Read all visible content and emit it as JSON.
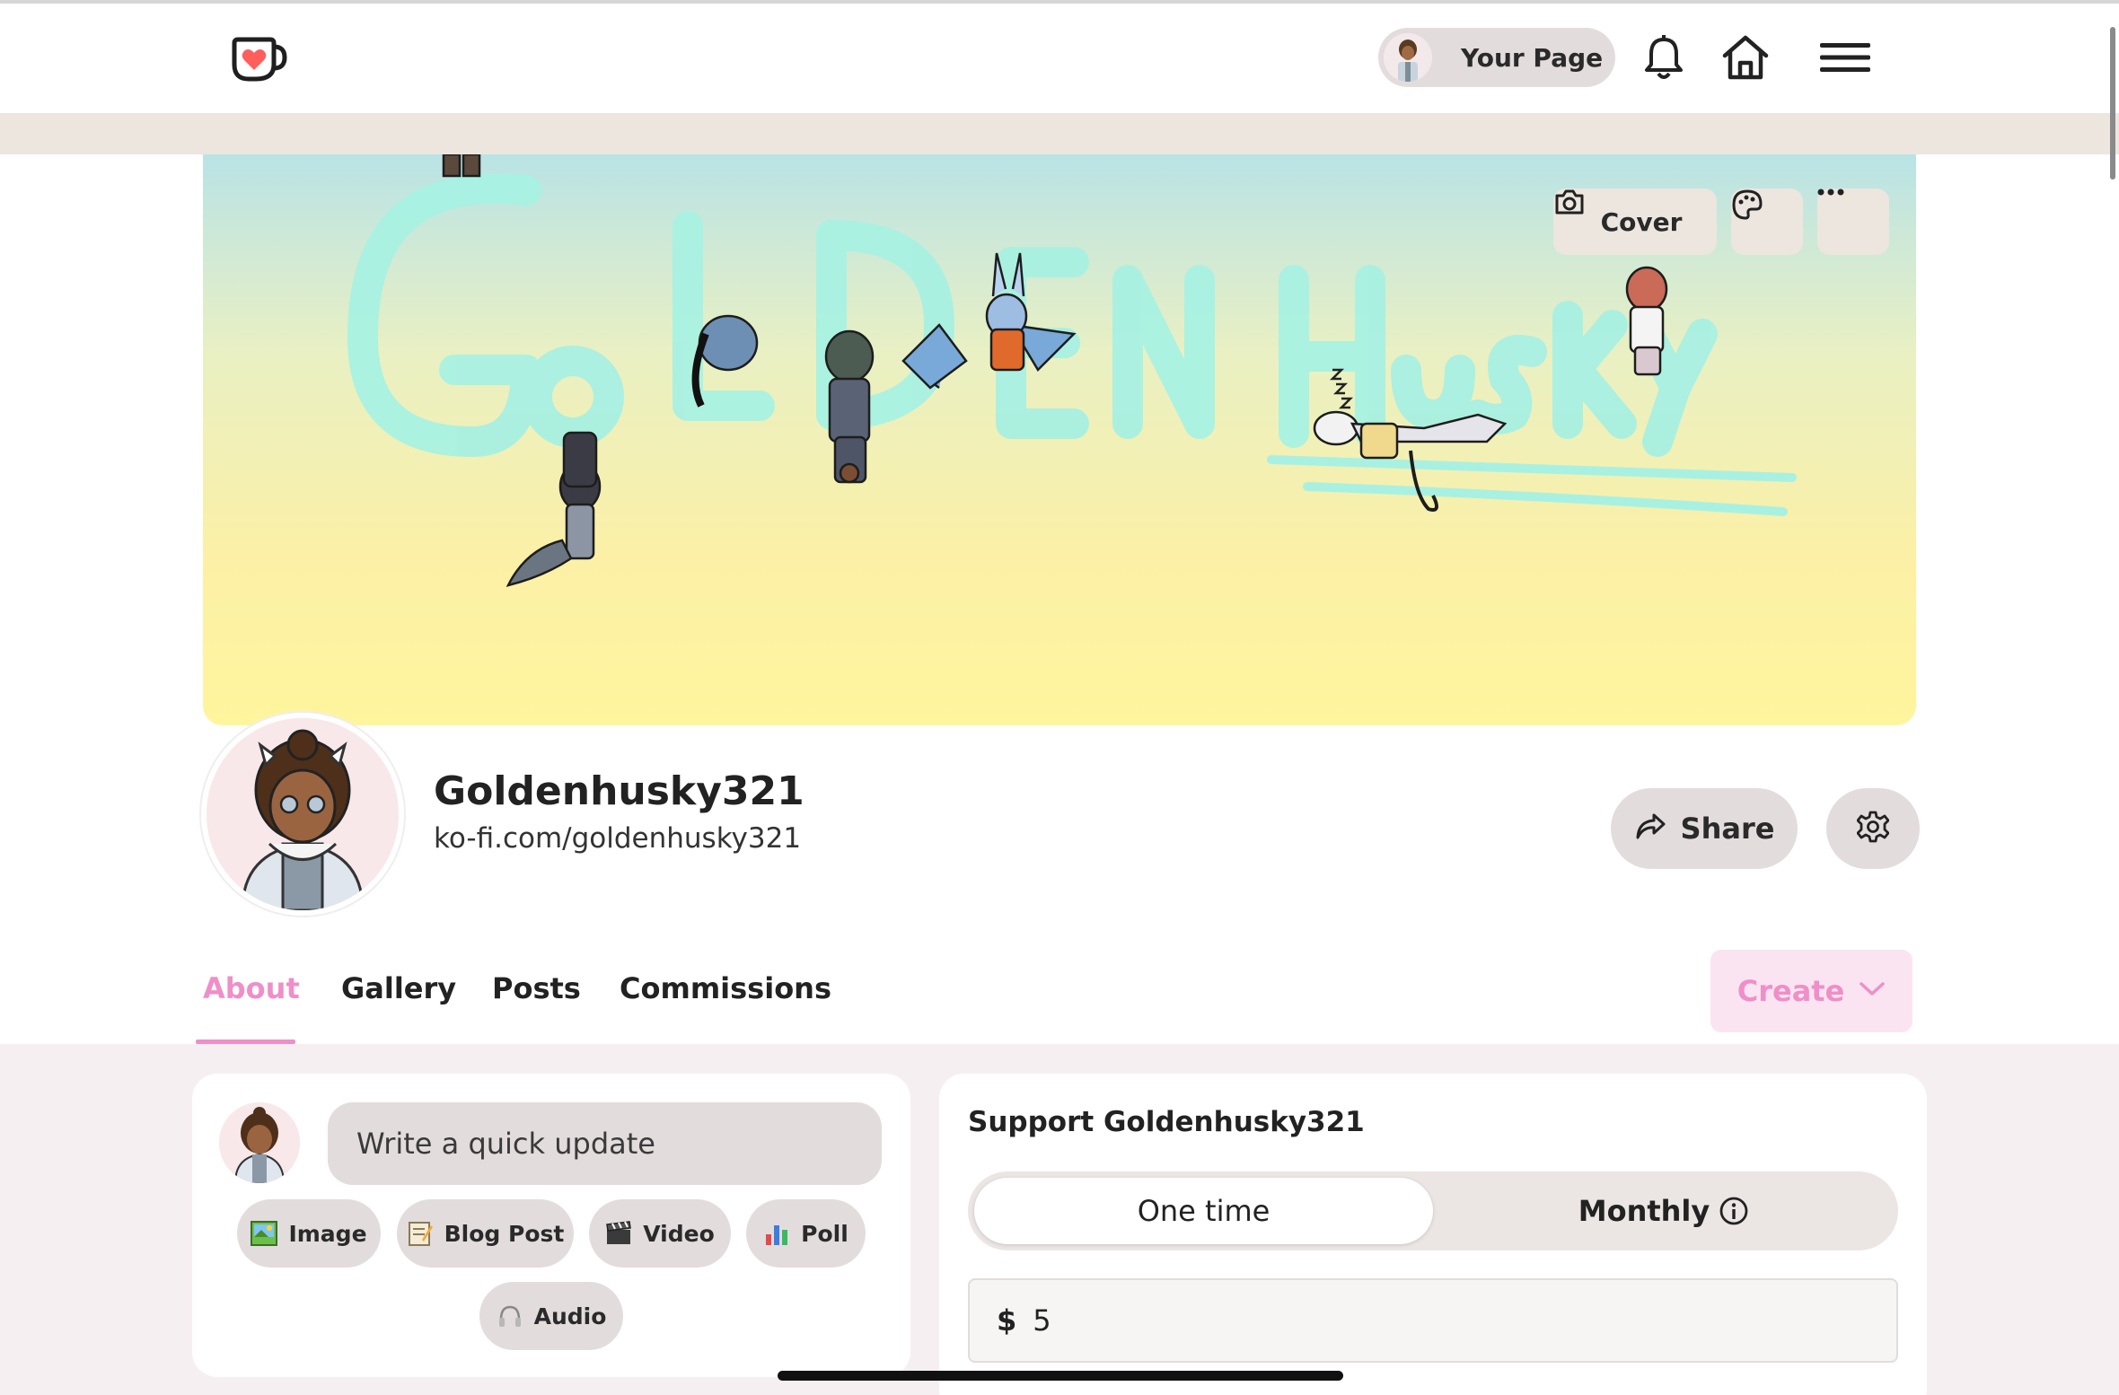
{
  "header": {
    "your_page_label": "Your Page"
  },
  "cover": {
    "cover_button_label": "Cover"
  },
  "profile": {
    "name": "Goldenhusky321",
    "url": "ko-fi.com/goldenhusky321",
    "share_label": "Share"
  },
  "tabs": [
    {
      "label": "About",
      "active": true
    },
    {
      "label": "Gallery",
      "active": false
    },
    {
      "label": "Posts",
      "active": false
    },
    {
      "label": "Commissions",
      "active": false
    }
  ],
  "create_label": "Create",
  "quick_update": {
    "placeholder": "Write a quick update",
    "buttons": [
      {
        "label": "Image",
        "icon": "picture-icon"
      },
      {
        "label": "Blog Post",
        "icon": "memo-icon"
      },
      {
        "label": "Video",
        "icon": "clapper-icon"
      },
      {
        "label": "Poll",
        "icon": "bar-chart-icon"
      },
      {
        "label": "Audio",
        "icon": "headphones-icon"
      }
    ]
  },
  "support": {
    "title": "Support Goldenhusky321",
    "one_time_label": "One time",
    "monthly_label": "Monthly",
    "currency": "$",
    "amount": "5"
  },
  "colors": {
    "accent_pink": "#ef8fc8",
    "pill_bg": "#e3dcdc",
    "logo_red": "#ff5e5b"
  }
}
